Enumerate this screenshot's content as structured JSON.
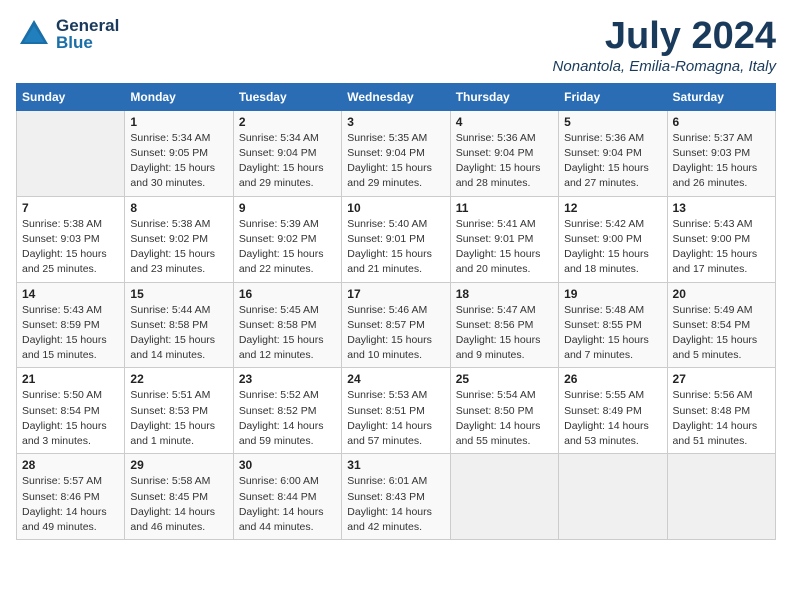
{
  "header": {
    "logo_general": "General",
    "logo_blue": "Blue",
    "month": "July 2024",
    "location": "Nonantola, Emilia-Romagna, Italy"
  },
  "days_of_week": [
    "Sunday",
    "Monday",
    "Tuesday",
    "Wednesday",
    "Thursday",
    "Friday",
    "Saturday"
  ],
  "weeks": [
    [
      {
        "day": "",
        "info": ""
      },
      {
        "day": "1",
        "info": "Sunrise: 5:34 AM\nSunset: 9:05 PM\nDaylight: 15 hours\nand 30 minutes."
      },
      {
        "day": "2",
        "info": "Sunrise: 5:34 AM\nSunset: 9:04 PM\nDaylight: 15 hours\nand 29 minutes."
      },
      {
        "day": "3",
        "info": "Sunrise: 5:35 AM\nSunset: 9:04 PM\nDaylight: 15 hours\nand 29 minutes."
      },
      {
        "day": "4",
        "info": "Sunrise: 5:36 AM\nSunset: 9:04 PM\nDaylight: 15 hours\nand 28 minutes."
      },
      {
        "day": "5",
        "info": "Sunrise: 5:36 AM\nSunset: 9:04 PM\nDaylight: 15 hours\nand 27 minutes."
      },
      {
        "day": "6",
        "info": "Sunrise: 5:37 AM\nSunset: 9:03 PM\nDaylight: 15 hours\nand 26 minutes."
      }
    ],
    [
      {
        "day": "7",
        "info": "Sunrise: 5:38 AM\nSunset: 9:03 PM\nDaylight: 15 hours\nand 25 minutes."
      },
      {
        "day": "8",
        "info": "Sunrise: 5:38 AM\nSunset: 9:02 PM\nDaylight: 15 hours\nand 23 minutes."
      },
      {
        "day": "9",
        "info": "Sunrise: 5:39 AM\nSunset: 9:02 PM\nDaylight: 15 hours\nand 22 minutes."
      },
      {
        "day": "10",
        "info": "Sunrise: 5:40 AM\nSunset: 9:01 PM\nDaylight: 15 hours\nand 21 minutes."
      },
      {
        "day": "11",
        "info": "Sunrise: 5:41 AM\nSunset: 9:01 PM\nDaylight: 15 hours\nand 20 minutes."
      },
      {
        "day": "12",
        "info": "Sunrise: 5:42 AM\nSunset: 9:00 PM\nDaylight: 15 hours\nand 18 minutes."
      },
      {
        "day": "13",
        "info": "Sunrise: 5:43 AM\nSunset: 9:00 PM\nDaylight: 15 hours\nand 17 minutes."
      }
    ],
    [
      {
        "day": "14",
        "info": "Sunrise: 5:43 AM\nSunset: 8:59 PM\nDaylight: 15 hours\nand 15 minutes."
      },
      {
        "day": "15",
        "info": "Sunrise: 5:44 AM\nSunset: 8:58 PM\nDaylight: 15 hours\nand 14 minutes."
      },
      {
        "day": "16",
        "info": "Sunrise: 5:45 AM\nSunset: 8:58 PM\nDaylight: 15 hours\nand 12 minutes."
      },
      {
        "day": "17",
        "info": "Sunrise: 5:46 AM\nSunset: 8:57 PM\nDaylight: 15 hours\nand 10 minutes."
      },
      {
        "day": "18",
        "info": "Sunrise: 5:47 AM\nSunset: 8:56 PM\nDaylight: 15 hours\nand 9 minutes."
      },
      {
        "day": "19",
        "info": "Sunrise: 5:48 AM\nSunset: 8:55 PM\nDaylight: 15 hours\nand 7 minutes."
      },
      {
        "day": "20",
        "info": "Sunrise: 5:49 AM\nSunset: 8:54 PM\nDaylight: 15 hours\nand 5 minutes."
      }
    ],
    [
      {
        "day": "21",
        "info": "Sunrise: 5:50 AM\nSunset: 8:54 PM\nDaylight: 15 hours\nand 3 minutes."
      },
      {
        "day": "22",
        "info": "Sunrise: 5:51 AM\nSunset: 8:53 PM\nDaylight: 15 hours\nand 1 minute."
      },
      {
        "day": "23",
        "info": "Sunrise: 5:52 AM\nSunset: 8:52 PM\nDaylight: 14 hours\nand 59 minutes."
      },
      {
        "day": "24",
        "info": "Sunrise: 5:53 AM\nSunset: 8:51 PM\nDaylight: 14 hours\nand 57 minutes."
      },
      {
        "day": "25",
        "info": "Sunrise: 5:54 AM\nSunset: 8:50 PM\nDaylight: 14 hours\nand 55 minutes."
      },
      {
        "day": "26",
        "info": "Sunrise: 5:55 AM\nSunset: 8:49 PM\nDaylight: 14 hours\nand 53 minutes."
      },
      {
        "day": "27",
        "info": "Sunrise: 5:56 AM\nSunset: 8:48 PM\nDaylight: 14 hours\nand 51 minutes."
      }
    ],
    [
      {
        "day": "28",
        "info": "Sunrise: 5:57 AM\nSunset: 8:46 PM\nDaylight: 14 hours\nand 49 minutes."
      },
      {
        "day": "29",
        "info": "Sunrise: 5:58 AM\nSunset: 8:45 PM\nDaylight: 14 hours\nand 46 minutes."
      },
      {
        "day": "30",
        "info": "Sunrise: 6:00 AM\nSunset: 8:44 PM\nDaylight: 14 hours\nand 44 minutes."
      },
      {
        "day": "31",
        "info": "Sunrise: 6:01 AM\nSunset: 8:43 PM\nDaylight: 14 hours\nand 42 minutes."
      },
      {
        "day": "",
        "info": ""
      },
      {
        "day": "",
        "info": ""
      },
      {
        "day": "",
        "info": ""
      }
    ]
  ]
}
